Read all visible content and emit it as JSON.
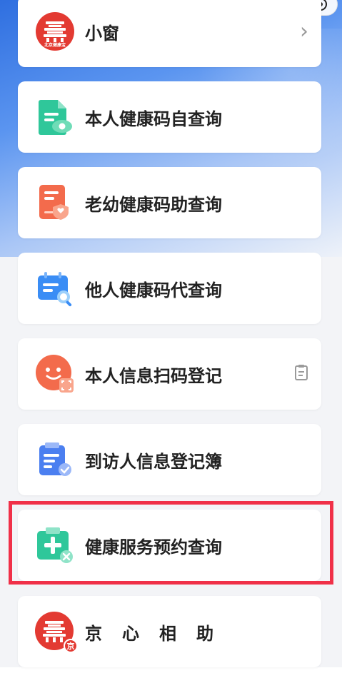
{
  "capsule": {
    "more_glyph": "•••",
    "close_icon": "target-icon"
  },
  "cards": [
    {
      "label": "小窗",
      "icon": "beijing-health-logo-icon",
      "logo_text": "北京健康宝",
      "right": "›"
    },
    {
      "label": "本人健康码自查询",
      "icon": "health-code-self-icon"
    },
    {
      "label": "老幼健康码助查询",
      "icon": "health-code-assist-icon"
    },
    {
      "label": "他人健康码代查询",
      "icon": "health-code-proxy-icon"
    },
    {
      "label": "本人信息扫码登记",
      "icon": "scan-register-face-icon",
      "right_icon": "clipboard-icon"
    },
    {
      "label": "到访人信息登记簿",
      "icon": "visitor-register-icon"
    },
    {
      "label": "健康服务预约查询",
      "icon": "health-service-booking-icon"
    },
    {
      "label": "京心相助",
      "icon": "jingxin-logo-icon",
      "badge": "京"
    }
  ],
  "colors": {
    "accent_red": "#f03048",
    "green": "#2fc79a",
    "orange": "#f36b4c",
    "blue": "#3a8df5",
    "logo_red": "#e33a32"
  }
}
